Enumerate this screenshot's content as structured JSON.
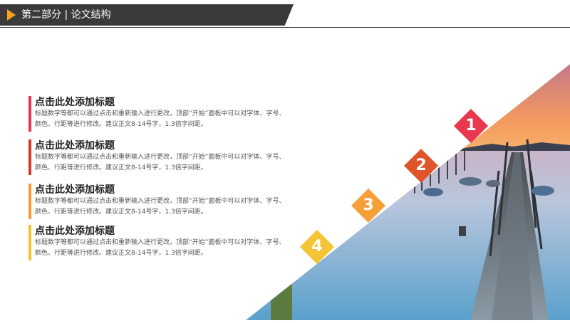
{
  "header": {
    "title": "第二部分 | 论文结构"
  },
  "items": [
    {
      "title": "点击此处添加标题",
      "body": "标题数字等都可以通过点击和重新输入进行更改，顶部“开始”面板中可以对字体、字号、颜色、行距等进行修改。建议正文8-14号字，1.3倍字间距。",
      "color": "#e8384f"
    },
    {
      "title": "点击此处添加标题",
      "body": "标题数字等都可以通过点击和重新输入进行更改，顶部“开始”面板中可以对字体、字号、颜色、行距等进行修改。建议正文8-14号字，1.3倍字间距。",
      "color": "#d7372b"
    },
    {
      "title": "点击此处添加标题",
      "body": "标题数字等都可以通过点击和重新输入进行更改，顶部“开始”面板中可以对字体、字号、颜色、行距等进行修改。建议正文8-14号字，1.3倍字间距。",
      "color": "#f39c33"
    },
    {
      "title": "点击此处添加标题",
      "body": "标题数字等都可以通过点击和重新输入进行更改，顶部“开始”面板中可以对字体、字号、颜色、行距等进行修改。建议正文8-14号字，1.3倍字间距。",
      "color": "#f2c230"
    }
  ],
  "badges": [
    {
      "number": "1",
      "color": "#e8384f"
    },
    {
      "number": "2",
      "color": "#e0542a"
    },
    {
      "number": "3",
      "color": "#f59f38"
    },
    {
      "number": "4",
      "color": "#f3c534"
    }
  ],
  "colors": {
    "header_bg": "#3a3a3c",
    "header_accent": "#f5a11d"
  }
}
